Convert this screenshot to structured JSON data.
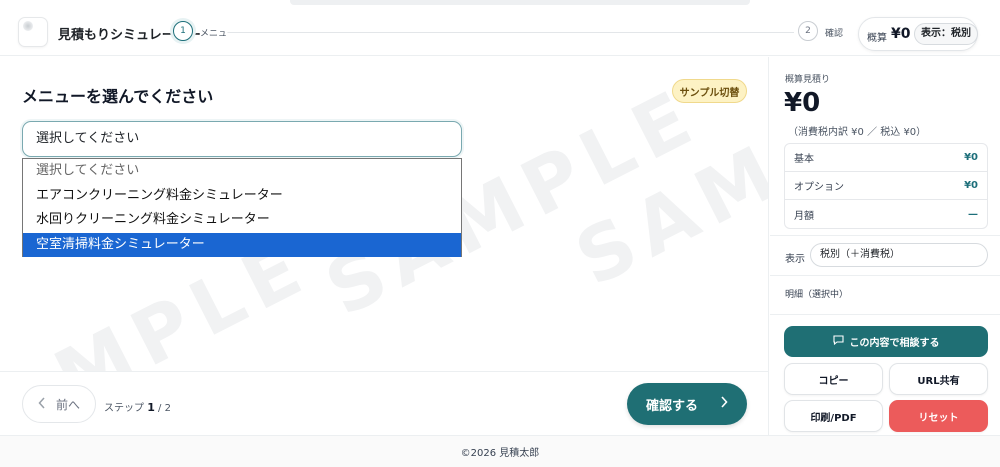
{
  "header": {
    "app_title": "見積もりシミュレーター",
    "steps": [
      {
        "number": "1",
        "label": "メニュー"
      },
      {
        "number": "2",
        "label": "確認"
      }
    ],
    "summary_label": "概算",
    "summary_amount": "¥0",
    "tax_toggle": "表示：税別"
  },
  "main": {
    "heading": "メニューを選んでください",
    "sample_toggle": "サンプル切替",
    "select_value": "選択してください",
    "options": [
      "選択してください",
      "エアコンクリーニング料金シミュレーター",
      "水回りクリーニング料金シミュレーター",
      "空室清掃料金シミュレーター"
    ],
    "watermark": "SAMPLE",
    "prev_button": "前へ",
    "step_prefix": "ステップ",
    "step_current": "1",
    "step_total": "/ 2",
    "confirm_button": "確認する"
  },
  "sidebar": {
    "title": "概算見積り",
    "total": "¥0",
    "tax_note": "（消費税内訳 ¥0 ／ 税込 ¥0）",
    "rows": [
      {
        "label": "基本",
        "value": "¥0"
      },
      {
        "label": "オプション",
        "value": "¥0"
      },
      {
        "label": "月額",
        "value": "—"
      }
    ],
    "display_label": "表示",
    "display_value": "税別（＋消費税）",
    "detail_label": "明細（選択中）",
    "consult_button": "この内容で相談する",
    "copy_button": "コピー",
    "url_button": "URL共有",
    "print_button": "印刷/PDF",
    "reset_button": "リセット"
  },
  "footer": {
    "copyright": "©2026 見積太郎"
  },
  "colors": {
    "accent": "#1f6f74",
    "selected_option": "#1a66d2",
    "reset": "#ec5b5b",
    "sample_badge": "#fdf2c4"
  }
}
